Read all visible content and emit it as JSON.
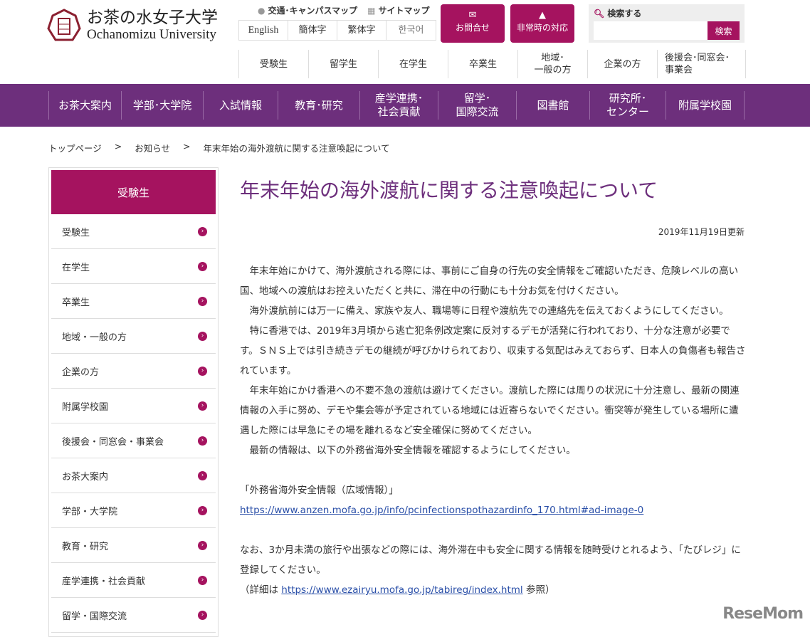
{
  "header": {
    "logo_jp": "お茶の水女子大学",
    "logo_en": "Ochanomizu University",
    "util": [
      {
        "icon": "map-pin-icon",
        "label": "交通･キャンパスマップ"
      },
      {
        "icon": "sitemap-icon",
        "label": "サイトマップ"
      }
    ],
    "languages": [
      "English",
      "簡体字",
      "繁体字",
      "한국어"
    ],
    "contact": "お問合せ",
    "emergency": "非常時の対応",
    "search_label": "検索する",
    "search_button": "検索",
    "search_value": ""
  },
  "subnav": [
    "受験生",
    "留学生",
    "在学生",
    "卒業生",
    "地域･\n一般の方",
    "企業の方",
    "後援会･同窓会･\n事業会"
  ],
  "mainnav": [
    "お茶大案内",
    "学部･大学院",
    "入試情報",
    "教育･研究",
    "産学連携･\n社会貢献",
    "留学･\n国際交流",
    "図書館",
    "研究所･\nセンター",
    "附属学校園"
  ],
  "breadcrumb": [
    "トップページ",
    ">",
    "お知らせ",
    ">",
    "年末年始の海外渡航に関する注意喚起について"
  ],
  "sidebar": {
    "header": "受験生",
    "items": [
      "受験生",
      "在学生",
      "卒業生",
      "地域・一般の方",
      "企業の方",
      "附属学校園",
      "後援会・同窓会・事業会",
      "お茶大案内",
      "学部・大学院",
      "教育・研究",
      "産学連携・社会貢献",
      "留学・国際交流"
    ]
  },
  "article": {
    "title": "年末年始の海外渡航に関する注意喚起について",
    "date": "2019年11月19日更新",
    "p1": "　年末年始にかけて、海外渡航される際には、事前にご自身の行先の安全情報をご確認いただき、危険レベルの高い国、地域への渡航はお控えいただくと共に、滞在中の行動にも十分お気を付けください。",
    "p2": "　海外渡航前には万一に備え、家族や友人、職場等に日程や渡航先での連絡先を伝えておくようにしてください。",
    "p3": "　特に香港では、2019年3月頃から逃亡犯条例改定案に反対するデモが活発に行われており、十分な注意が必要です。ＳＮＳ上では引き続きデモの継続が呼びかけられており、収束する気配はみえておらず、日本人の負傷者も報告されています。",
    "p4": "　年末年始にかけ香港への不要不急の渡航は避けてください。渡航した際には周りの状況に十分注意し、最新の関連情報の入手に努め、デモや集会等が予定されている地域には近寄らないでください。衝突等が発生している場所に遭遇した際には早急にその場を離れるなど安全確保に努めてください。",
    "p5": "　最新の情報は、以下の外務省海外安全情報を確認するようにしてください。",
    "link1_label": "「外務省海外安全情報（広域情報）」",
    "link1": "https://www.anzen.mofa.go.jp/info/pcinfectionspothazardinfo_170.html#ad-image-0",
    "p6": " なお、3か月未満の旅行や出張などの際には、海外滞在中も安全に関する情報を随時受けとれるよう、「たびレジ」に登録してください。",
    "p7_pre": "（詳細は ",
    "link2": "https://www.ezairyu.mofa.go.jp/tabireg/index.html",
    "p7_post": " 参照）"
  },
  "watermark": "ReseMom"
}
